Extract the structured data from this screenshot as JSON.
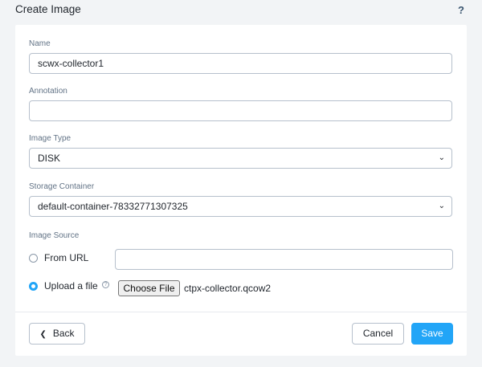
{
  "dialog": {
    "title": "Create Image",
    "help_icon": "?"
  },
  "form": {
    "name": {
      "label": "Name",
      "value": "scwx-collector1"
    },
    "annotation": {
      "label": "Annotation",
      "value": ""
    },
    "image_type": {
      "label": "Image Type",
      "value": "DISK"
    },
    "storage_container": {
      "label": "Storage Container",
      "value": "default-container-78332771307325"
    },
    "image_source": {
      "label": "Image Source",
      "options": [
        {
          "label": "From URL",
          "selected": false,
          "url_value": ""
        },
        {
          "label": "Upload a file",
          "selected": true,
          "info_icon": "?"
        }
      ],
      "choose_file_label": "Choose File",
      "file_name": "ctpx-collector.qcow2"
    }
  },
  "footer": {
    "back_label": "Back",
    "cancel_label": "Cancel",
    "save_label": "Save"
  },
  "icons": {
    "chevron": "⌄",
    "back_arrow": "❮"
  },
  "colors": {
    "accent": "#22a5f7",
    "label_text": "#627386",
    "background": "#f2f4f6"
  }
}
